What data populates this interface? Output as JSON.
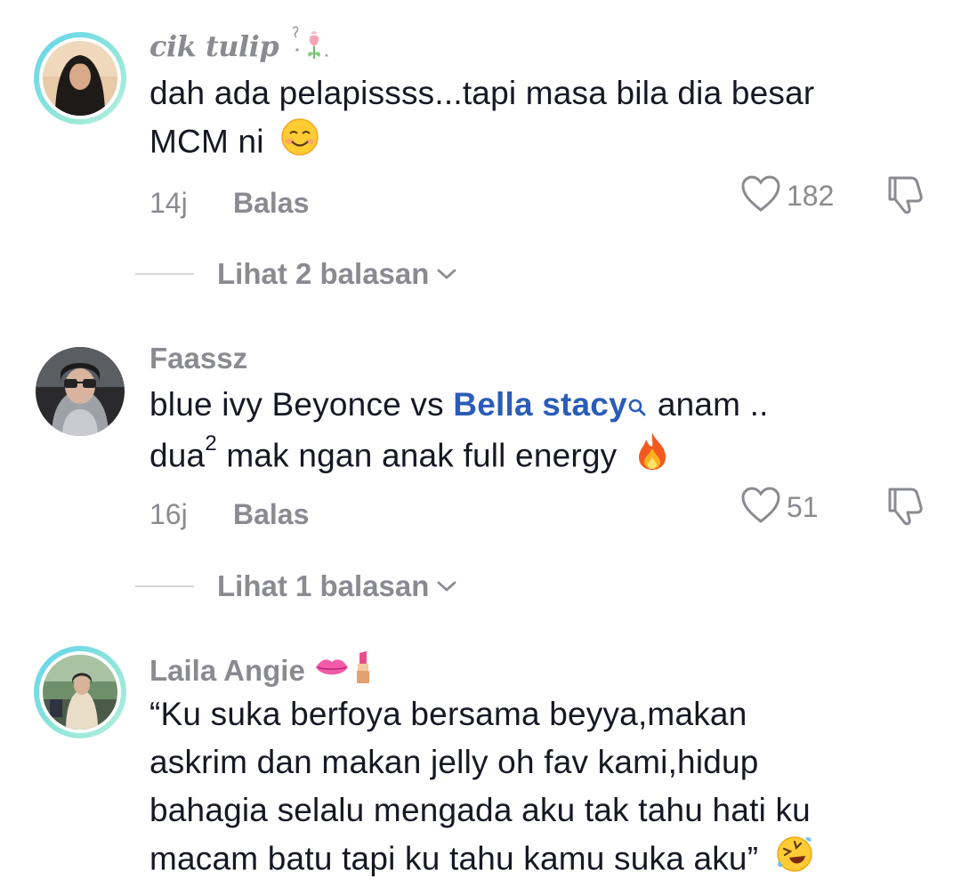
{
  "comments": [
    {
      "username": "cik tulip",
      "text_lines": [
        "dah ada pelapissss...tapi masa bila dia besar",
        "MCM ni"
      ],
      "time": "14j",
      "reply_label": "Balas",
      "likes": "182",
      "view_replies": "Lihat 2 balasan",
      "emoji": "smiling-face-icon",
      "name_icon": "tulip-icon"
    },
    {
      "username": "Faassz",
      "text_prefix": "blue ivy Beyonce vs ",
      "mention": "Bella stacy",
      "text_after_mention": "anam ..",
      "line2_prefix": "dua",
      "line2_sup": "2",
      "line2_rest": " mak ngan anak full energy",
      "time": "16j",
      "reply_label": "Balas",
      "likes": "51",
      "view_replies": "Lihat 1 balasan",
      "emoji": "fire-icon"
    },
    {
      "username": "Laila Angie",
      "text_lines": [
        "“Ku suka berfoya bersama beyya,makan",
        "askrim dan makan jelly oh fav kami,hidup",
        "bahagia selalu mengada aku tak tahu hati ku",
        "macam batu tapi ku tahu kamu suka aku”"
      ],
      "emoji": "rolling-laughing-icon",
      "name_icons": [
        "lips-icon",
        "lipstick-icon"
      ]
    }
  ],
  "colors": {
    "muted": "#8a8b91",
    "text": "#161823",
    "mention": "#2b5cb8",
    "ring": "#5fd3f0"
  }
}
